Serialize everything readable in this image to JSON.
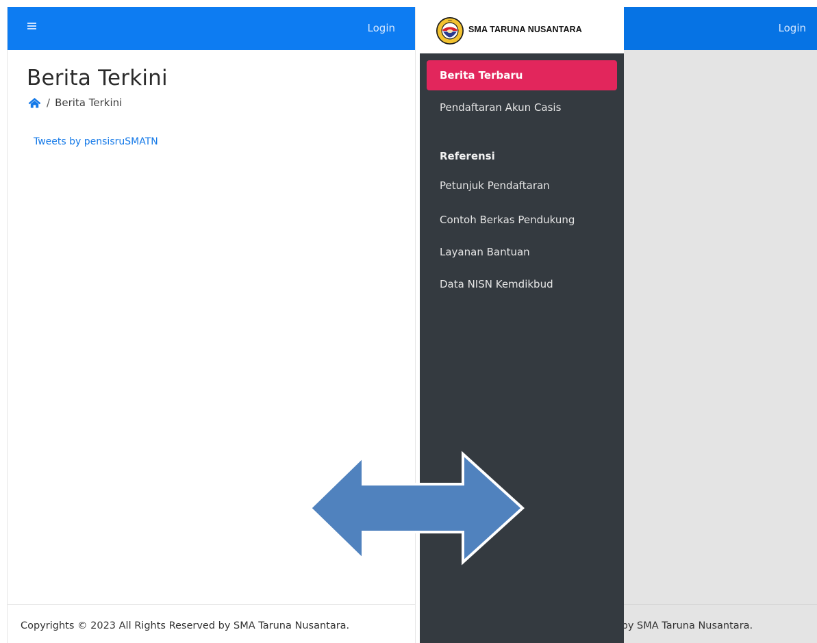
{
  "left": {
    "topbar": {
      "login_label": "Login"
    },
    "page_title": "Berita Terkini",
    "breadcrumb": {
      "separator": "/",
      "current": "Berita Terkini"
    },
    "tweets_link": "Tweets by pensisruSMATN",
    "footer_text": "Copyrights © 2023 All Rights Reserved by SMA Taruna Nusantara."
  },
  "right": {
    "topbar": {
      "login_label": "Login"
    },
    "brand": {
      "name": "SMA TARUNA NUSANTARA"
    },
    "sidebar": {
      "items": [
        {
          "label": "Berita Terbaru"
        },
        {
          "label": "Pendaftaran Akun Casis"
        }
      ],
      "section_header": "Referensi",
      "ref_items": [
        {
          "label": "Petunjuk Pendaftaran"
        },
        {
          "label": "Contoh Berkas Pendukung"
        },
        {
          "label": "Layanan Bantuan"
        },
        {
          "label": "Data NISN Kemdikbud"
        }
      ]
    },
    "footer_text": "l by SMA Taruna Nusantara."
  },
  "colors": {
    "topbar": "#0d7cf2",
    "sidebar": "#343a40",
    "active_item": "#e2265c",
    "link": "#1479e8",
    "arrow": "#5082be"
  },
  "icons": {
    "hamburger": "bars-icon",
    "home": "home-icon",
    "arrow": "double-arrow-icon"
  }
}
